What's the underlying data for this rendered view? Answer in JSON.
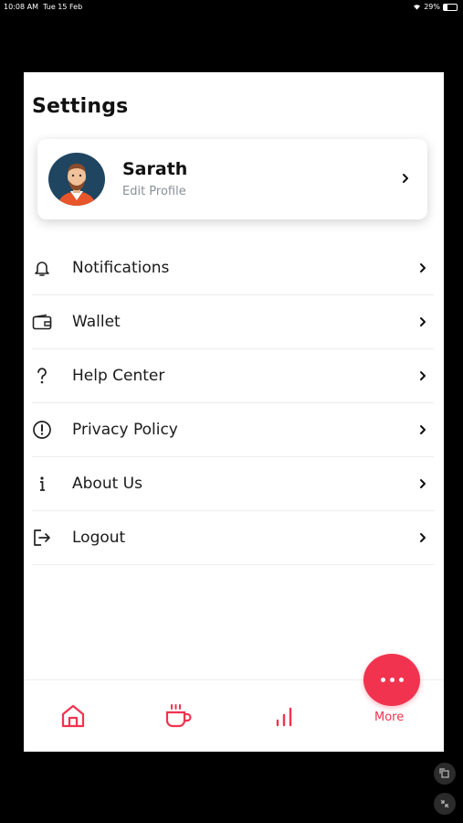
{
  "status": {
    "time": "10:08 AM",
    "date": "Tue 15 Feb",
    "battery": "29%",
    "battery_level": 0.29
  },
  "header": {
    "title": "Settings"
  },
  "profile": {
    "name": "Sarath",
    "subtitle": "Edit Profile"
  },
  "menu": {
    "items": [
      {
        "label": "Notifications",
        "icon": "bell-icon"
      },
      {
        "label": "Wallet",
        "icon": "wallet-icon"
      },
      {
        "label": "Help Center",
        "icon": "question-icon"
      },
      {
        "label": "Privacy Policy",
        "icon": "alert-circle-icon"
      },
      {
        "label": "About Us",
        "icon": "info-icon"
      },
      {
        "label": "Logout",
        "icon": "logout-icon"
      }
    ]
  },
  "bottom_nav": {
    "items": [
      {
        "icon": "home-icon"
      },
      {
        "icon": "coffee-cup-icon"
      },
      {
        "icon": "bar-chart-icon"
      }
    ],
    "more_label": "More"
  },
  "colors": {
    "accent": "#f2334f",
    "text": "#111111",
    "muted": "#8a8f99",
    "divider": "#ececec"
  }
}
